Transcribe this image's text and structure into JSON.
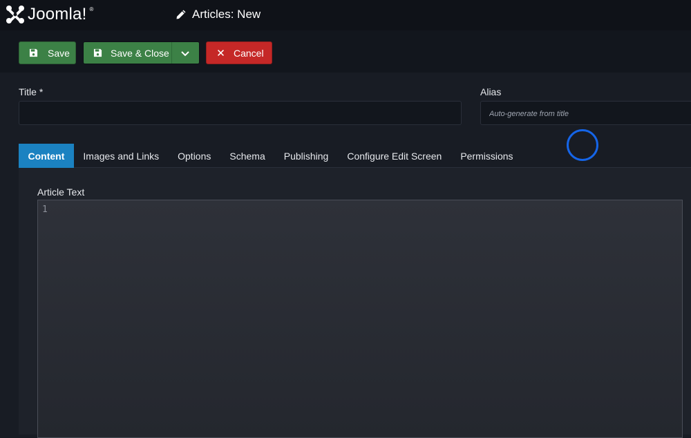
{
  "header": {
    "logo_text": "Joomla!",
    "logo_reg": "®",
    "page_title": "Articles: New"
  },
  "toolbar": {
    "save_label": "Save",
    "save_close_label": "Save & Close",
    "cancel_label": "Cancel"
  },
  "form": {
    "title_label": "Title *",
    "title_value": "",
    "alias_label": "Alias",
    "alias_placeholder": "Auto-generate from title"
  },
  "tabs": [
    {
      "label": "Content",
      "active": true
    },
    {
      "label": "Images and Links",
      "active": false
    },
    {
      "label": "Options",
      "active": false
    },
    {
      "label": "Schema",
      "active": false
    },
    {
      "label": "Publishing",
      "active": false
    },
    {
      "label": "Configure Edit Screen",
      "active": false
    },
    {
      "label": "Permissions",
      "active": false
    }
  ],
  "editor": {
    "label": "Article Text",
    "line_number": "1"
  },
  "colors": {
    "success": "#3c8146",
    "danger": "#c52827",
    "active_tab": "#1b82c1",
    "cursor_ring": "#1565e8"
  },
  "icons": {
    "logo": "joomla-logo-icon",
    "heading": "pencil-icon",
    "save": "floppy-disk-icon",
    "save_close": "floppy-disk-icon",
    "dropdown": "chevron-down-icon",
    "cancel": "close-icon"
  }
}
